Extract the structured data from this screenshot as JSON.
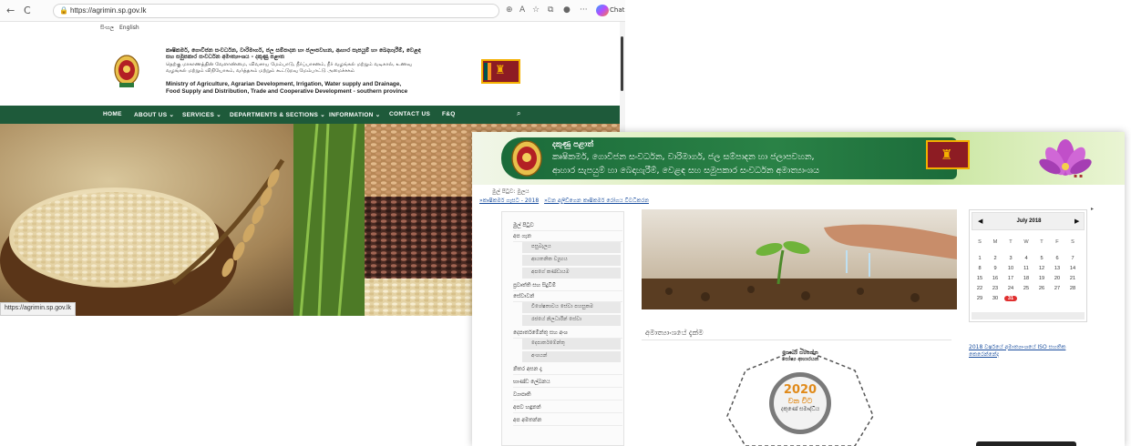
{
  "browser": {
    "nav_back": "←",
    "nav_refresh": "C",
    "url": "https://agrimin.sp.gov.lk",
    "toolbar_icons": [
      "zoom-icon",
      "read-aloud-icon",
      "favorite-icon",
      "collections-icon",
      "profile-icon",
      "more-icon"
    ],
    "copilot_label": "Chat",
    "status_url": "https://agrimin.sp.gov.lk"
  },
  "site1": {
    "languages": [
      "සිංහල",
      "English"
    ],
    "ministry_sinhala": "කෘෂිකර්ම, ගොවිජන සංවර්ධන, වාරිමාර්ග, ජල සම්පාදන හා ජලාපවහන, ආහාර සැපයුම් හා බෙදාහැරීම්, වෙළඳ සහ සමුපකාර සංවර්ධන අමාත්‍යාංශය - දකුණු පළාත",
    "ministry_tamil": "தெற்கு மாகாணத்தின் வேளாண்மை, விவசாய மேம்பாடு, நீர்ப்பாசனம், நீர் வழங்கல் மற்றும் வடிகால், உணவு வழங்கல் மற்றும் விநியோகம், வர்த்தகம் மற்றும் கூட்டுறவு மேம்பாட்டு அமைச்சகம்",
    "ministry_english_1": "Ministry of Agriculture, Agrarian Development, Irrigation, Water supply and Drainage,",
    "ministry_english_2": "Food Supply and Distribution, Trade and Cooperative Development - southern province",
    "nav": [
      "HOME",
      "ABOUT US ⌄",
      "SERVICES ⌄",
      "DEPARTMENTS & SECTIONS ⌄",
      "INFORMATION ⌄",
      "CONTACT US",
      "F&Q"
    ],
    "colors": {
      "nav_bg": "#1e5a3a"
    }
  },
  "site2": {
    "banner_line1": "දකුණු පළාත්",
    "banner_line2": "කෘෂිකර්ම, ගොවිජන සංවර්ධන, වාරිමාර්ග, ජල සම්පාදන හා ජලාපවහන,",
    "banner_line3": "ආහාර සැපයුම් හා බෙදාහැරීම්, වෙළඳ සහ සමුපකාර සංවර්ධන අමාත්‍යාංශය",
    "breadcrumb": "මුල් පිටුව: මුලය",
    "top_links": [
      "»කෘෂිකර්ම ගැසට - 2018",
      "»වන අලිඩ්ගෙන කෘෂිකර්ම රෝගය විවධිකරන"
    ],
    "sidebar": [
      {
        "label": "මුල් පිටුව",
        "sub": false
      },
      {
        "label": "අප ගැන",
        "sub": false
      },
      {
        "label": "පසුබැලය",
        "sub": true
      },
      {
        "label": "ආයතනික ව්‍යුහය",
        "sub": true
      },
      {
        "label": "අපගේ කණ්ඩායම",
        "sub": true
      },
      {
        "label": "ප්‍රවෘත්ති සහ සිදුවීම්",
        "sub": false
      },
      {
        "label": "සේවාවන්",
        "sub": false
      },
      {
        "label": "විශේෂතාවය සේවා පහසුකම",
        "sub": true
      },
      {
        "label": "රජයේ නිලධාරීන් සේවා",
        "sub": true
      },
      {
        "label": "දෙපාර්තමේන්තු සහ අංශ",
        "sub": false
      },
      {
        "label": "දෙපාර්තමේන්තු",
        "sub": true
      },
      {
        "label": "අංශයන්",
        "sub": true
      },
      {
        "label": "නිතර අසන දෑ",
        "sub": false
      },
      {
        "label": "භාණ්ඩ ලේඛනය",
        "sub": false
      },
      {
        "label": "ව්‍යාපෘති",
        "sub": false
      },
      {
        "label": "අපව හඳුනන්",
        "sub": false
      },
      {
        "label": "අප අමතන්න",
        "sub": false
      }
    ],
    "vision_heading": "අමාත්‍යාංශයේ දැක්ම",
    "badge_center": [
      "2020",
      "වන විට",
      "දකුණේ සමෘද්ධිය"
    ],
    "badge_top": [
      "සෞඛ්‍ය සම්පන්න",
      "පෝෂ්‍ය ආහාරයන්"
    ],
    "calendar": {
      "month": "July 2018",
      "prev": "◀",
      "next": "▶",
      "dow": [
        "S",
        "M",
        "T",
        "W",
        "T",
        "F",
        "S"
      ],
      "weeks": [
        [
          "1",
          "2",
          "3",
          "4",
          "5",
          "6",
          "7"
        ],
        [
          "8",
          "9",
          "10",
          "11",
          "12",
          "13",
          "14"
        ],
        [
          "15",
          "16",
          "17",
          "18",
          "19",
          "20",
          "21"
        ],
        [
          "22",
          "23",
          "24",
          "25",
          "26",
          "27",
          "28"
        ],
        [
          "29",
          "30",
          "31",
          "",
          "",
          "",
          ""
        ]
      ],
      "today": "31",
      "colors": {
        "today": "#e03030"
      }
    },
    "iso_link": "2018 වර්ෂයේ අමාත්‍යාංශයේ ISO සහතික කෙරෙන්නේද"
  }
}
